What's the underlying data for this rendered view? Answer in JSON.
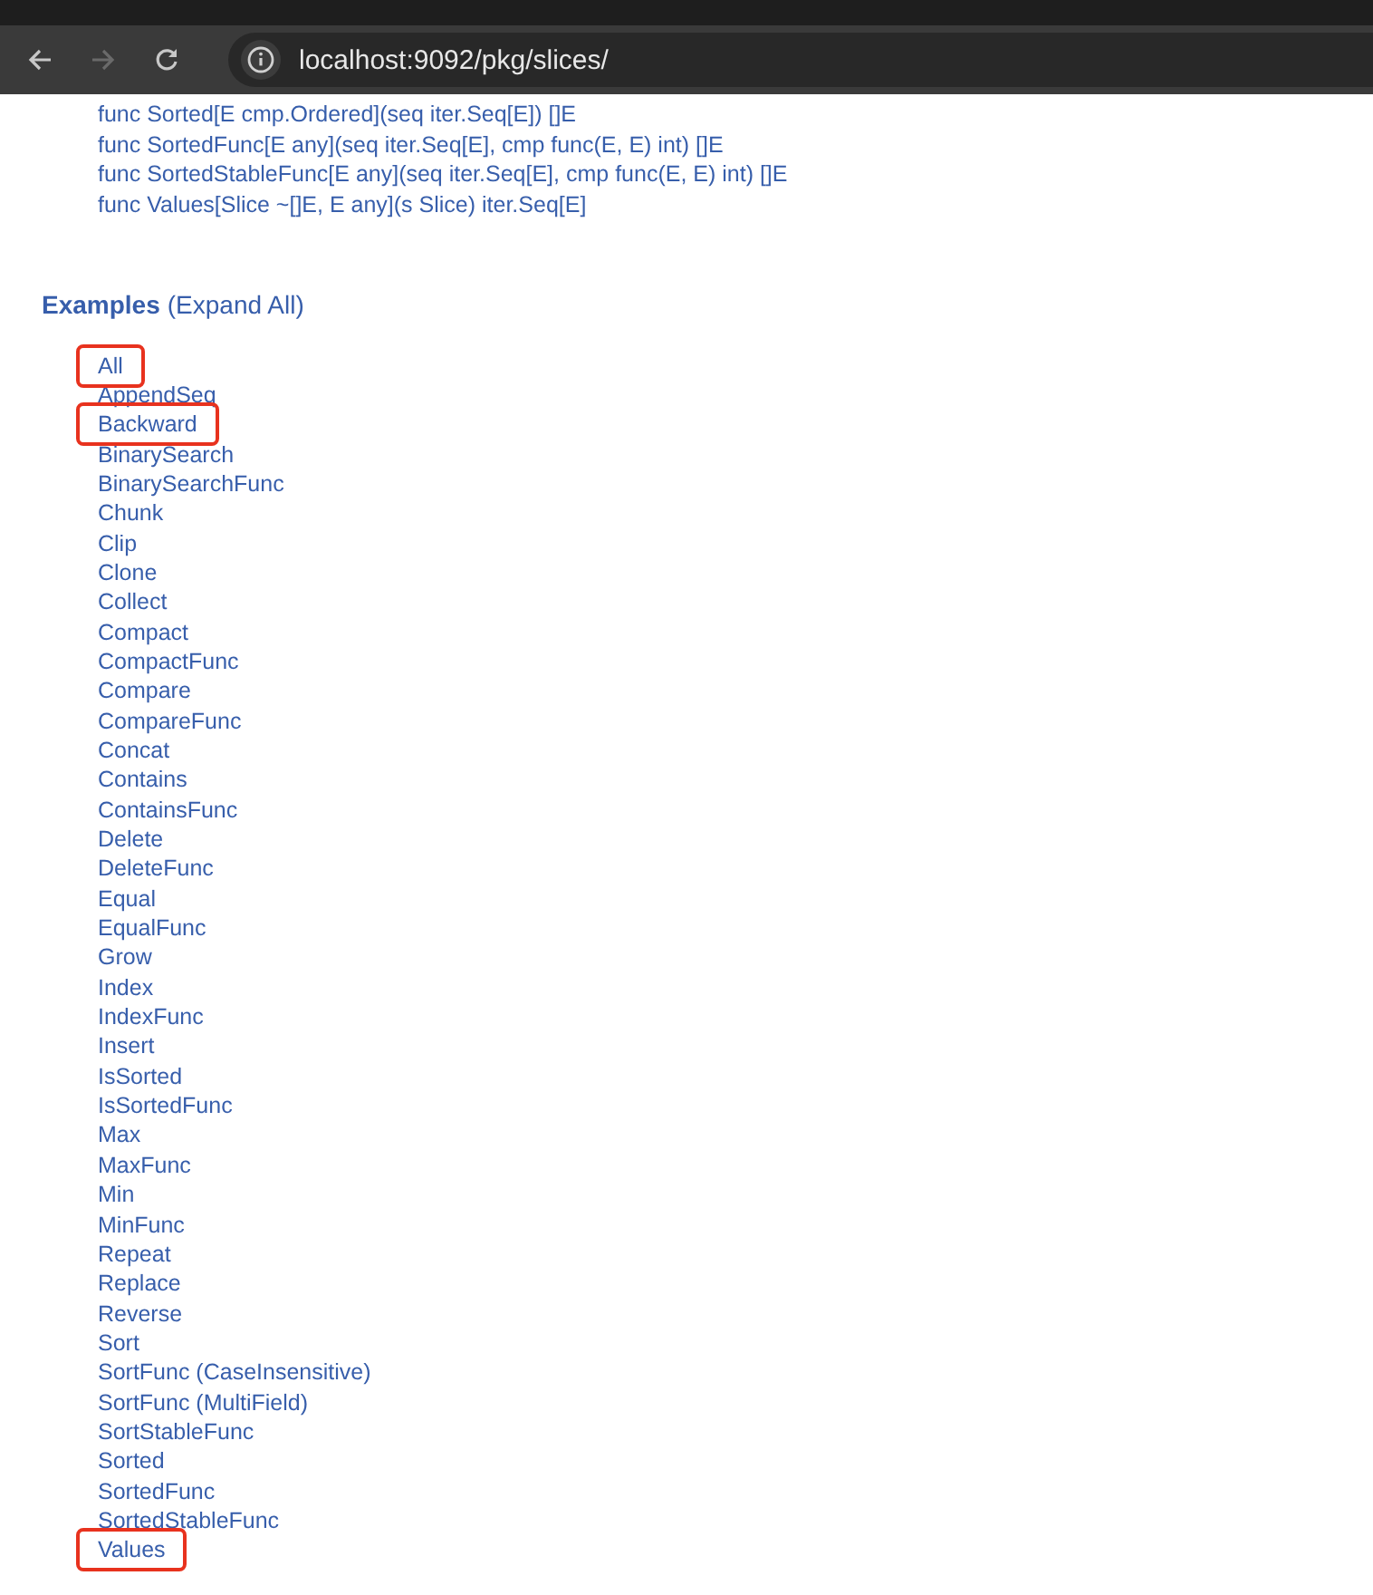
{
  "browser": {
    "url": "localhost:9092/pkg/slices/",
    "forward_disabled": true
  },
  "signatures": [
    "func Sorted[E cmp.Ordered](seq iter.Seq[E]) []E",
    "func SortedFunc[E any](seq iter.Seq[E], cmp func(E, E) int) []E",
    "func SortedStableFunc[E any](seq iter.Seq[E], cmp func(E, E) int) []E",
    "func Values[Slice ~[]E, E any](s Slice) iter.Seq[E]"
  ],
  "examples": {
    "title": "Examples",
    "expand_all": "(Expand All)",
    "items": [
      {
        "label": "All",
        "highlighted": true
      },
      {
        "label": "AppendSeq",
        "highlighted": false
      },
      {
        "label": "Backward",
        "highlighted": true
      },
      {
        "label": "BinarySearch",
        "highlighted": false
      },
      {
        "label": "BinarySearchFunc",
        "highlighted": false
      },
      {
        "label": "Chunk",
        "highlighted": false
      },
      {
        "label": "Clip",
        "highlighted": false
      },
      {
        "label": "Clone",
        "highlighted": false
      },
      {
        "label": "Collect",
        "highlighted": false
      },
      {
        "label": "Compact",
        "highlighted": false
      },
      {
        "label": "CompactFunc",
        "highlighted": false
      },
      {
        "label": "Compare",
        "highlighted": false
      },
      {
        "label": "CompareFunc",
        "highlighted": false
      },
      {
        "label": "Concat",
        "highlighted": false
      },
      {
        "label": "Contains",
        "highlighted": false
      },
      {
        "label": "ContainsFunc",
        "highlighted": false
      },
      {
        "label": "Delete",
        "highlighted": false
      },
      {
        "label": "DeleteFunc",
        "highlighted": false
      },
      {
        "label": "Equal",
        "highlighted": false
      },
      {
        "label": "EqualFunc",
        "highlighted": false
      },
      {
        "label": "Grow",
        "highlighted": false
      },
      {
        "label": "Index",
        "highlighted": false
      },
      {
        "label": "IndexFunc",
        "highlighted": false
      },
      {
        "label": "Insert",
        "highlighted": false
      },
      {
        "label": "IsSorted",
        "highlighted": false
      },
      {
        "label": "IsSortedFunc",
        "highlighted": false
      },
      {
        "label": "Max",
        "highlighted": false
      },
      {
        "label": "MaxFunc",
        "highlighted": false
      },
      {
        "label": "Min",
        "highlighted": false
      },
      {
        "label": "MinFunc",
        "highlighted": false
      },
      {
        "label": "Repeat",
        "highlighted": false
      },
      {
        "label": "Replace",
        "highlighted": false
      },
      {
        "label": "Reverse",
        "highlighted": false
      },
      {
        "label": "Sort",
        "highlighted": false
      },
      {
        "label": "SortFunc (CaseInsensitive)",
        "highlighted": false
      },
      {
        "label": "SortFunc (MultiField)",
        "highlighted": false
      },
      {
        "label": "SortStableFunc",
        "highlighted": false
      },
      {
        "label": "Sorted",
        "highlighted": false
      },
      {
        "label": "SortedFunc",
        "highlighted": false
      },
      {
        "label": "SortedStableFunc",
        "highlighted": false
      },
      {
        "label": "Values",
        "highlighted": true
      }
    ]
  }
}
